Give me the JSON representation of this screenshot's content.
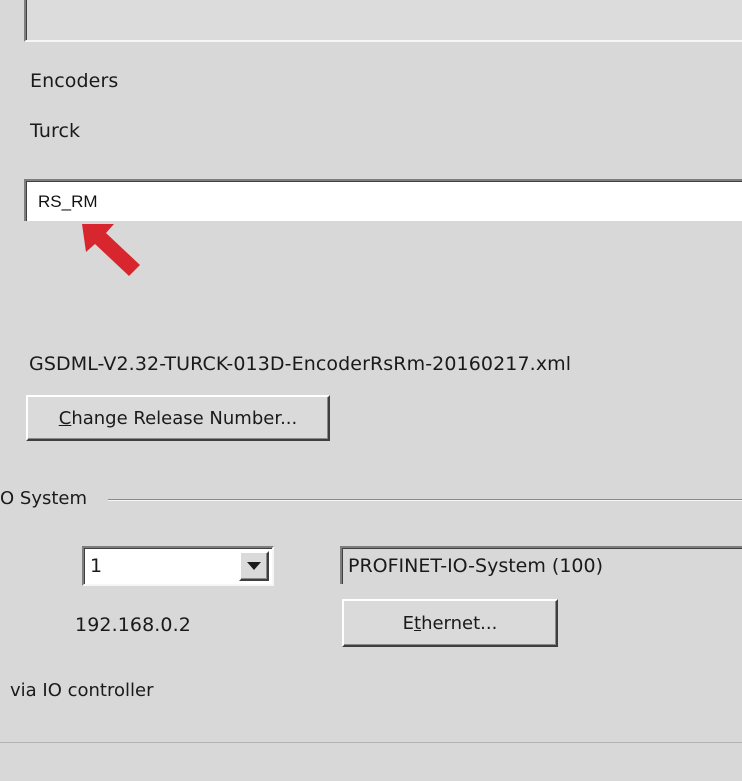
{
  "labels": {
    "category": "Encoders",
    "vendor": "Turck",
    "gsdml_file": "GSDML-V2.32-TURCK-013D-EncoderRsRm-20160217.xml",
    "ip_address": "192.168.0.2",
    "via_controller": "via IO controller"
  },
  "device_name": {
    "value": "RS_RM"
  },
  "buttons": {
    "change_release_pre": "C",
    "change_release_rest": "hange Release Number...",
    "ethernet_pre": "E",
    "ethernet_mid": "t",
    "ethernet_rest": "hernet..."
  },
  "io_system_group": {
    "title": "O System"
  },
  "device_number": {
    "selected": "1"
  },
  "io_system": {
    "value": "PROFINET-IO-System (100)"
  },
  "annotation": {
    "arrow_color": "#d7262e"
  }
}
